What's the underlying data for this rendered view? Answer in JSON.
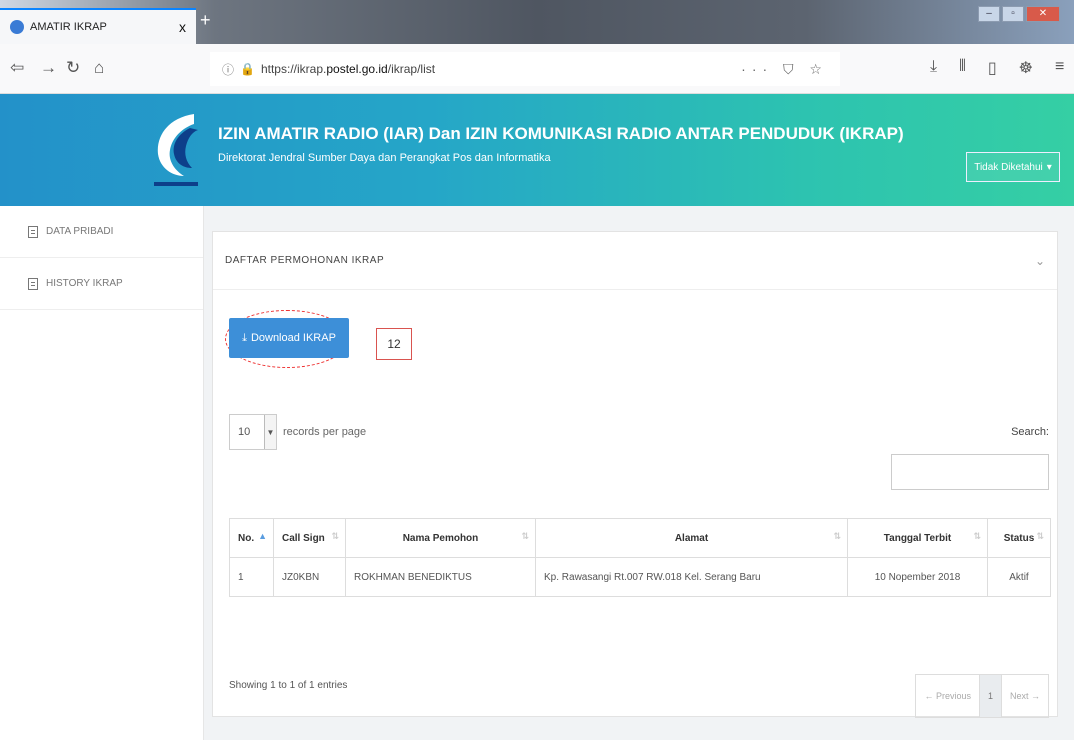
{
  "browser": {
    "tab_title": "AMATIR IKRAP",
    "tab_close": "x",
    "new_tab": "+",
    "url_prefix": "https://ikrap.",
    "url_domain": "postel.go.id",
    "url_path": "/ikrap/list",
    "url_actions": "··· ⛉ ☆",
    "tools": [
      "⤓",
      "⫴",
      "▯",
      "☸",
      "≡"
    ],
    "window_controls": [
      "–",
      "▫",
      "✕"
    ]
  },
  "header": {
    "title": "IZIN AMATIR RADIO (IAR) Dan IZIN KOMUNIKASI RADIO ANTAR PENDUDUK (IKRAP)",
    "subtitle": "Direktorat Jendral Sumber Daya dan Perangkat Pos dan Informatika",
    "user_button": "Tidak Diketahui"
  },
  "sidebar": {
    "items": [
      {
        "label": "DATA PRIBADI",
        "icon": "document-icon"
      },
      {
        "label": "HISTORY IKRAP",
        "icon": "document-icon"
      }
    ]
  },
  "panel": {
    "title": "DAFTAR PERMOHONAN IKRAP",
    "download_label": "Download IKRAP",
    "download_icon": "⤓",
    "count": "12",
    "page_length": "10",
    "length_label": "records per page",
    "search_label": "Search:",
    "search_value": "",
    "columns": [
      "No.",
      "Call Sign",
      "Nama Pemohon",
      "Alamat",
      "Tanggal Terbit",
      "Status"
    ],
    "rows": [
      [
        "1",
        "JZ0KBN",
        "ROKHMAN BENEDIKTUS",
        "Kp. Rawasangi Rt.007 RW.018 Kel. Serang Baru",
        "10 Nopember 2018",
        "Aktif"
      ]
    ],
    "info": "Showing 1 to 1 of 1 entries",
    "pager": {
      "prev": "← Previous",
      "page": "1",
      "next": "Next →"
    }
  },
  "colors": {
    "accent": "#3d8fd8",
    "header_start": "#2391c9",
    "header_end": "#35cfa4",
    "annotation": "#e33333"
  }
}
